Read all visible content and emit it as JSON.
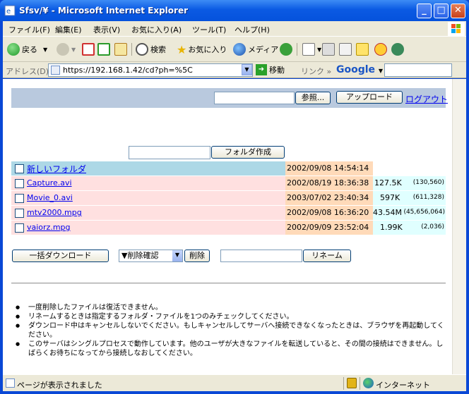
{
  "window": {
    "title": "Sfsv/¥ - Microsoft Internet Explorer",
    "buttons": {
      "minimize": "_",
      "maximize": "□",
      "close": "✕"
    }
  },
  "menu": [
    "ファイル(F)",
    "編集(E)",
    "表示(V)",
    "お気に入り(A)",
    "ツール(T)",
    "ヘルプ(H)"
  ],
  "toolbar": {
    "back": "戻る",
    "search": "検索",
    "favorites": "お気に入り",
    "media": "メディア"
  },
  "address": {
    "label": "アドレス(D)",
    "url": "https://192.168.1.42/cd?ph=%5C",
    "go": "移動",
    "links": "リンク",
    "google": "Google"
  },
  "upload": {
    "browse_label": "参照...",
    "upload_label": "アップロード",
    "logout_label": "ログアウト"
  },
  "folder": {
    "create_label": "フォルダ作成"
  },
  "files": [
    {
      "name": "新しいフォルダ",
      "date": "2002/09/08 14:54:14",
      "size": "",
      "bytes": "",
      "type": "folder"
    },
    {
      "name": "Capture.avi",
      "date": "2002/08/19 18:36:38",
      "size": "127.5K",
      "bytes": "(130,560)",
      "type": "file"
    },
    {
      "name": "Movie_0.avi",
      "date": "2003/07/02 23:40:34",
      "size": "597K",
      "bytes": "(611,328)",
      "type": "file"
    },
    {
      "name": "mtv2000.mpg",
      "date": "2002/09/08 16:36:20",
      "size": "43.54M",
      "bytes": "(45,656,064)",
      "type": "file"
    },
    {
      "name": "vaiorz.mpg",
      "date": "2002/09/09 23:52:04",
      "size": "1.99K",
      "bytes": "(2,036)",
      "type": "file"
    }
  ],
  "actions": {
    "bulk_download": "一括ダウンロード",
    "delete_select": "▼削除確認",
    "delete": "削除",
    "rename": "リネーム"
  },
  "notes": [
    "一度削除したファイルは復活できません。",
    "リネームするときは指定するフォルダ・ファイルを1つのみチェックしてください。",
    "ダウンロード中はキャンセルしないでください。もしキャンセルしてサーバへ接続できなくなったときは、ブラウザを再起動してください。",
    "このサーバはシングルプロセスで動作しています。他のユーザが大きなファイルを転送していると、その間の接続はできません。しばらくお待ちになってから接続しなおしてください。"
  ],
  "status": {
    "text": "ページが表示されました",
    "zone": "インターネット"
  },
  "colors": {
    "header_band": "#b9c9de",
    "folder_row": "#add8e6",
    "file_row": "#ffe0e0",
    "date_cell": "#ffdab9",
    "size_cell": "#e0ffff"
  }
}
